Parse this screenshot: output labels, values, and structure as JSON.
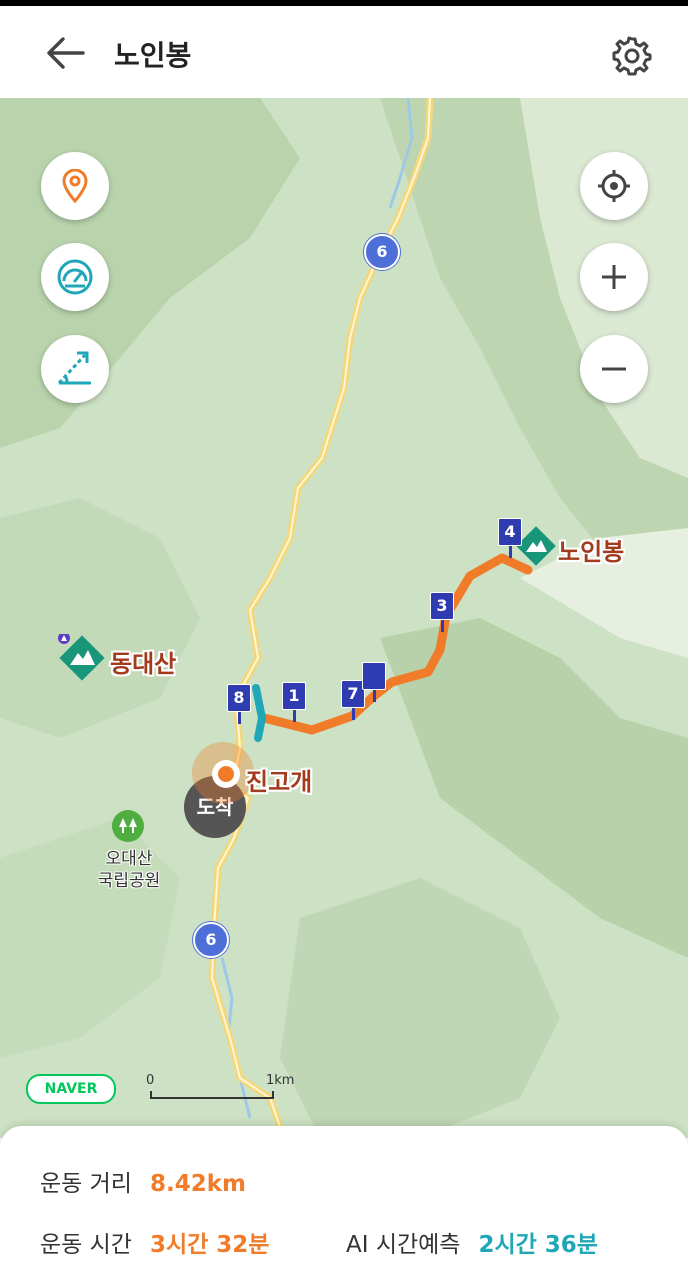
{
  "header": {
    "title": "노인봉",
    "back_icon": "arrow-left-icon",
    "settings_icon": "gear-icon"
  },
  "map": {
    "labels": {
      "peak_noinbong": "노인봉",
      "peak_dongdaesan": "동대산",
      "pass_jingogae": "진고개",
      "park_line1": "오대산",
      "park_line2": "국립공원",
      "arrival_badge": "도착"
    },
    "route_number_badges": [
      "6",
      "6"
    ],
    "markers": [
      "8",
      "1",
      "7",
      "",
      "3",
      "4"
    ],
    "buttons": {
      "location_pin": "location-pin-icon",
      "speedometer": "speedometer-icon",
      "slope": "slope-icon",
      "my_location": "crosshair-icon",
      "zoom_in": "plus-icon",
      "zoom_out": "minus-icon"
    },
    "provider": "NAVER",
    "scale_start": "0",
    "scale_end": "1km",
    "colors": {
      "route": "#f07c2a",
      "marker": "#2f3bb0",
      "road": "#f3d77a",
      "accent_teal": "#1fa7b8"
    }
  },
  "stats": {
    "distance_label": "운동 거리",
    "distance_value": "8.42km",
    "time_label": "운동 시간",
    "time_value": "3시간 32분",
    "ai_label": "AI 시간예측",
    "ai_value": "2시간 36분"
  }
}
